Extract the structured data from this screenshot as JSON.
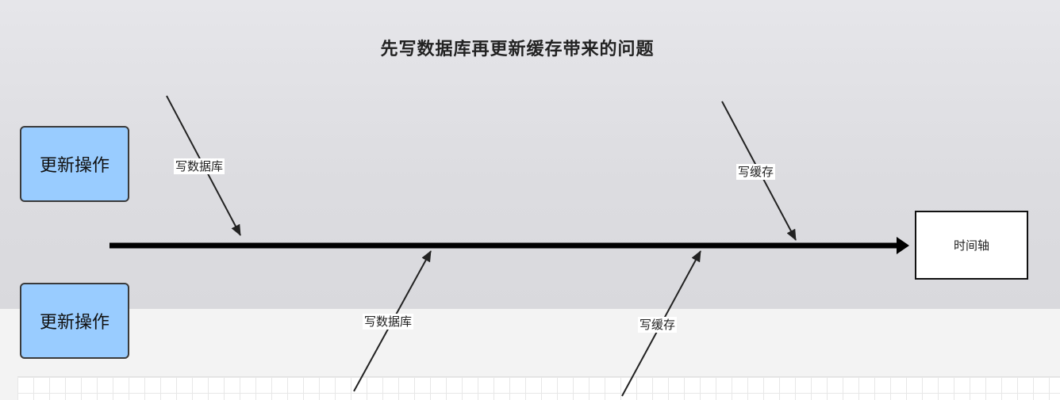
{
  "title": "先写数据库再更新缓存带来的问题",
  "nodes": {
    "op_top": "更新操作",
    "op_bottom": "更新操作",
    "timeline": "时间轴"
  },
  "edges": {
    "top_write_db": "写数据库",
    "top_write_cache": "写缓存",
    "bottom_write_db": "写数据库",
    "bottom_write_cache": "写缓存"
  },
  "colors": {
    "op_fill": "#99ccff",
    "timeline_fill": "#ffffff",
    "line": "#000000"
  }
}
